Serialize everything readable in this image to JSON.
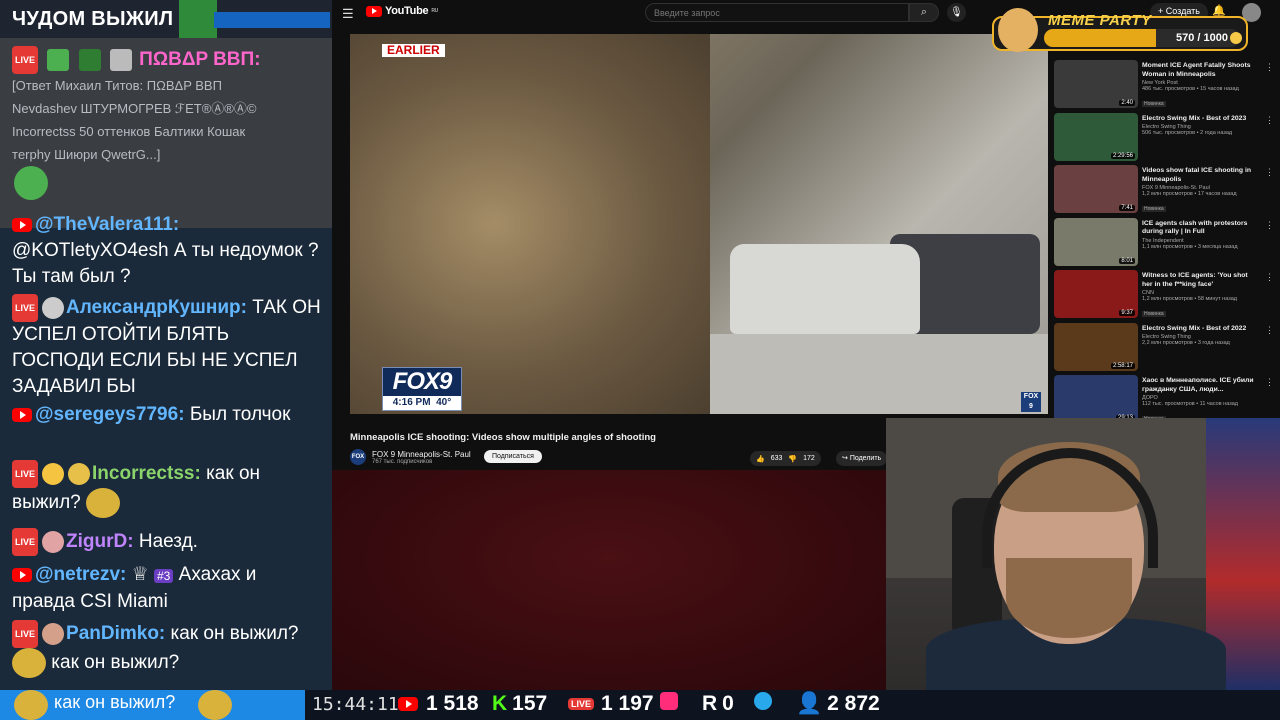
{
  "chat": {
    "header_title": "ЧУДОМ ВЫЖИЛ",
    "messages": [
      {
        "badge": "LIVE",
        "nick": "ΠΩBΔP ΒΒΠ:",
        "nick_color": "#ff66cc",
        "text": ""
      },
      {
        "badge": "",
        "nick": "",
        "nick_color": "#b8bcc2",
        "text": "[Ответ Михаил Титов: ΠΩBΔP ΒΒΠ Nevdashev ШТУРМОГРЕВ ℱET®Ⓐ®Ⓐ© Incorrectss 50 оттенков Балтики Кошак тerphy Шиюри QwetrG...]"
      },
      {
        "badge": "YT",
        "nick": "@TheValera111:",
        "nick_color": "#62b6ff",
        "text": "@KOTletyXO4esh А ты недоумок ? Ты там был ?"
      },
      {
        "badge": "LIVE",
        "nick": "АлександрКушнир:",
        "nick_color": "#62b6ff",
        "text": "ТАК ОН УСПЕЛ ОТОЙТИ БЛЯТЬ ГОСПОДИ ЕСЛИ БЫ НЕ УСПЕЛ ЗАДАВИЛ БЫ"
      },
      {
        "badge": "YT",
        "nick": "@seregeys7796:",
        "nick_color": "#62b6ff",
        "text": "Был толчок"
      },
      {
        "badge": "LIVE",
        "nick": "Incorrectss:",
        "nick_color": "#8bd36b",
        "text": "как он выжил?"
      },
      {
        "badge": "LIVE",
        "nick": "ZigurD:",
        "nick_color": "#c084fc",
        "text": "Наезд."
      },
      {
        "badge": "YT",
        "nick": "@netrezv:",
        "nick_color": "#62b6ff",
        "text": "Ахахах и правда CSI Miami",
        "rank": "#3"
      },
      {
        "badge": "LIVE",
        "nick": "PanDimko:",
        "nick_color": "#62b6ff",
        "text": "как он выжил?",
        "text2": "как он выжил?"
      }
    ],
    "bottom_line": "как он выжил?"
  },
  "stats": {
    "clock": "15:44:11",
    "youtube_viewers": "1 518",
    "kick_viewers": "157",
    "vk_viewers": "1 197",
    "rutube_viewers": "0",
    "total_viewers": "2 872"
  },
  "youtube": {
    "logo": "YouTube",
    "logo_sup": "RU",
    "search_placeholder": "Введите запрос",
    "create_label": "+ Создать",
    "video_banner": "EARLIER",
    "fox_logo": "FOX9",
    "fox_time": "4:16 PM",
    "fox_temp": "40°",
    "video_title": "Minneapolis ICE shooting: Videos show multiple angles of shooting",
    "channel_name": "FOX 9 Minneapolis-St. Paul",
    "channel_subs": "767 тыс. подписчиков",
    "subscribe_label": "Подписаться",
    "likes": "633",
    "dislikes": "172",
    "share_label": "Поделить",
    "suggestions": [
      {
        "title": "Moment ICE Agent Fatally Shoots Woman in Minneapolis",
        "channel": "New York Post",
        "meta": "486 тыс. просмотров • 15 часов назад",
        "duration": "2:40",
        "tag": "Новинка",
        "color": "#3a3a3a"
      },
      {
        "title": "Electro Swing Mix - Best of 2023",
        "channel": "Electro Swing Thing",
        "meta": "506 тыс. просмотров • 2 года назад",
        "duration": "2:29:56",
        "tag": "",
        "color": "#2f5a3a"
      },
      {
        "title": "Videos show fatal ICE shooting in Minneapolis",
        "channel": "FOX 9 Minneapolis-St. Paul",
        "meta": "1,2 млн просмотров • 17 часов назад",
        "duration": "7:41",
        "tag": "Новинка",
        "color": "#6a4040"
      },
      {
        "title": "ICE agents clash with protestors during rally | In Full",
        "channel": "The Independent",
        "meta": "1,1 млн просмотров • 3 месяца назад",
        "duration": "8:01",
        "tag": "",
        "color": "#7a7a6a"
      },
      {
        "title": "Witness to ICE agents: 'You shot her in the f**king face'",
        "channel": "CNN",
        "meta": "1,2 млн просмотров • 58 минут назад",
        "duration": "9:37",
        "tag": "Новинка",
        "color": "#8a1a1a"
      },
      {
        "title": "Electro Swing Mix - Best of 2022",
        "channel": "Electro Swing Thing",
        "meta": "2,2 млн просмотров • 3 года назад",
        "duration": "2:58:17",
        "tag": "",
        "color": "#5a3a1a"
      },
      {
        "title": "Хаос в Миннеаполисе. ICE убили гражданку США, люди...",
        "channel": "ДОРО",
        "meta": "112 тыс. просмотров • 11 часов назад",
        "duration": "29:13",
        "tag": "Новинка",
        "color": "#2a3a6a"
      }
    ]
  },
  "meme_party": {
    "title": "MEME PARTY",
    "score": "570 / 1000",
    "progress": 0.57
  }
}
